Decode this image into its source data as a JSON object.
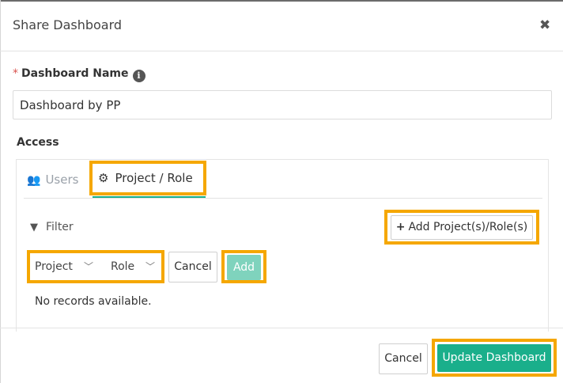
{
  "dialog": {
    "title": "Share Dashboard",
    "close_icon": "close-icon"
  },
  "form": {
    "required_mark": "*",
    "name_label": "Dashboard Name",
    "name_value": "Dashboard by PP",
    "access_label": "Access"
  },
  "tabs": {
    "users": "Users",
    "project_role": "Project / Role",
    "active": "project_role"
  },
  "filter": {
    "label": "Filter",
    "add_project_role": "Add Project(s)/Role(s)"
  },
  "selects": {
    "project": "Project",
    "role": "Role"
  },
  "row_actions": {
    "cancel": "Cancel",
    "add": "Add"
  },
  "empty_message": "No records available.",
  "footer": {
    "cancel": "Cancel",
    "update": "Update Dashboard"
  },
  "colors": {
    "accent": "#1aaf8b",
    "highlight": "#f5a700",
    "required": "#d9534f"
  }
}
